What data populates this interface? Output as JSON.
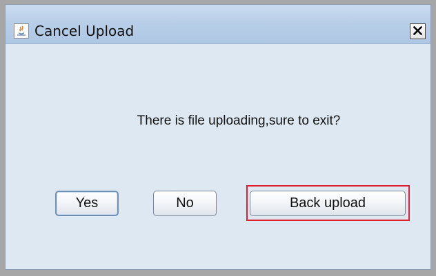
{
  "window": {
    "title": "Cancel Upload",
    "close_label": "✕",
    "icon": "java-cup-icon"
  },
  "message": "There is file uploading,sure to exit?",
  "buttons": {
    "yes": "Yes",
    "no": "No",
    "back_upload": "Back upload"
  },
  "colors": {
    "highlight_outline": "#e0202c",
    "dialog_background": "#dde8f3",
    "titlebar": "#b9cfe8"
  }
}
